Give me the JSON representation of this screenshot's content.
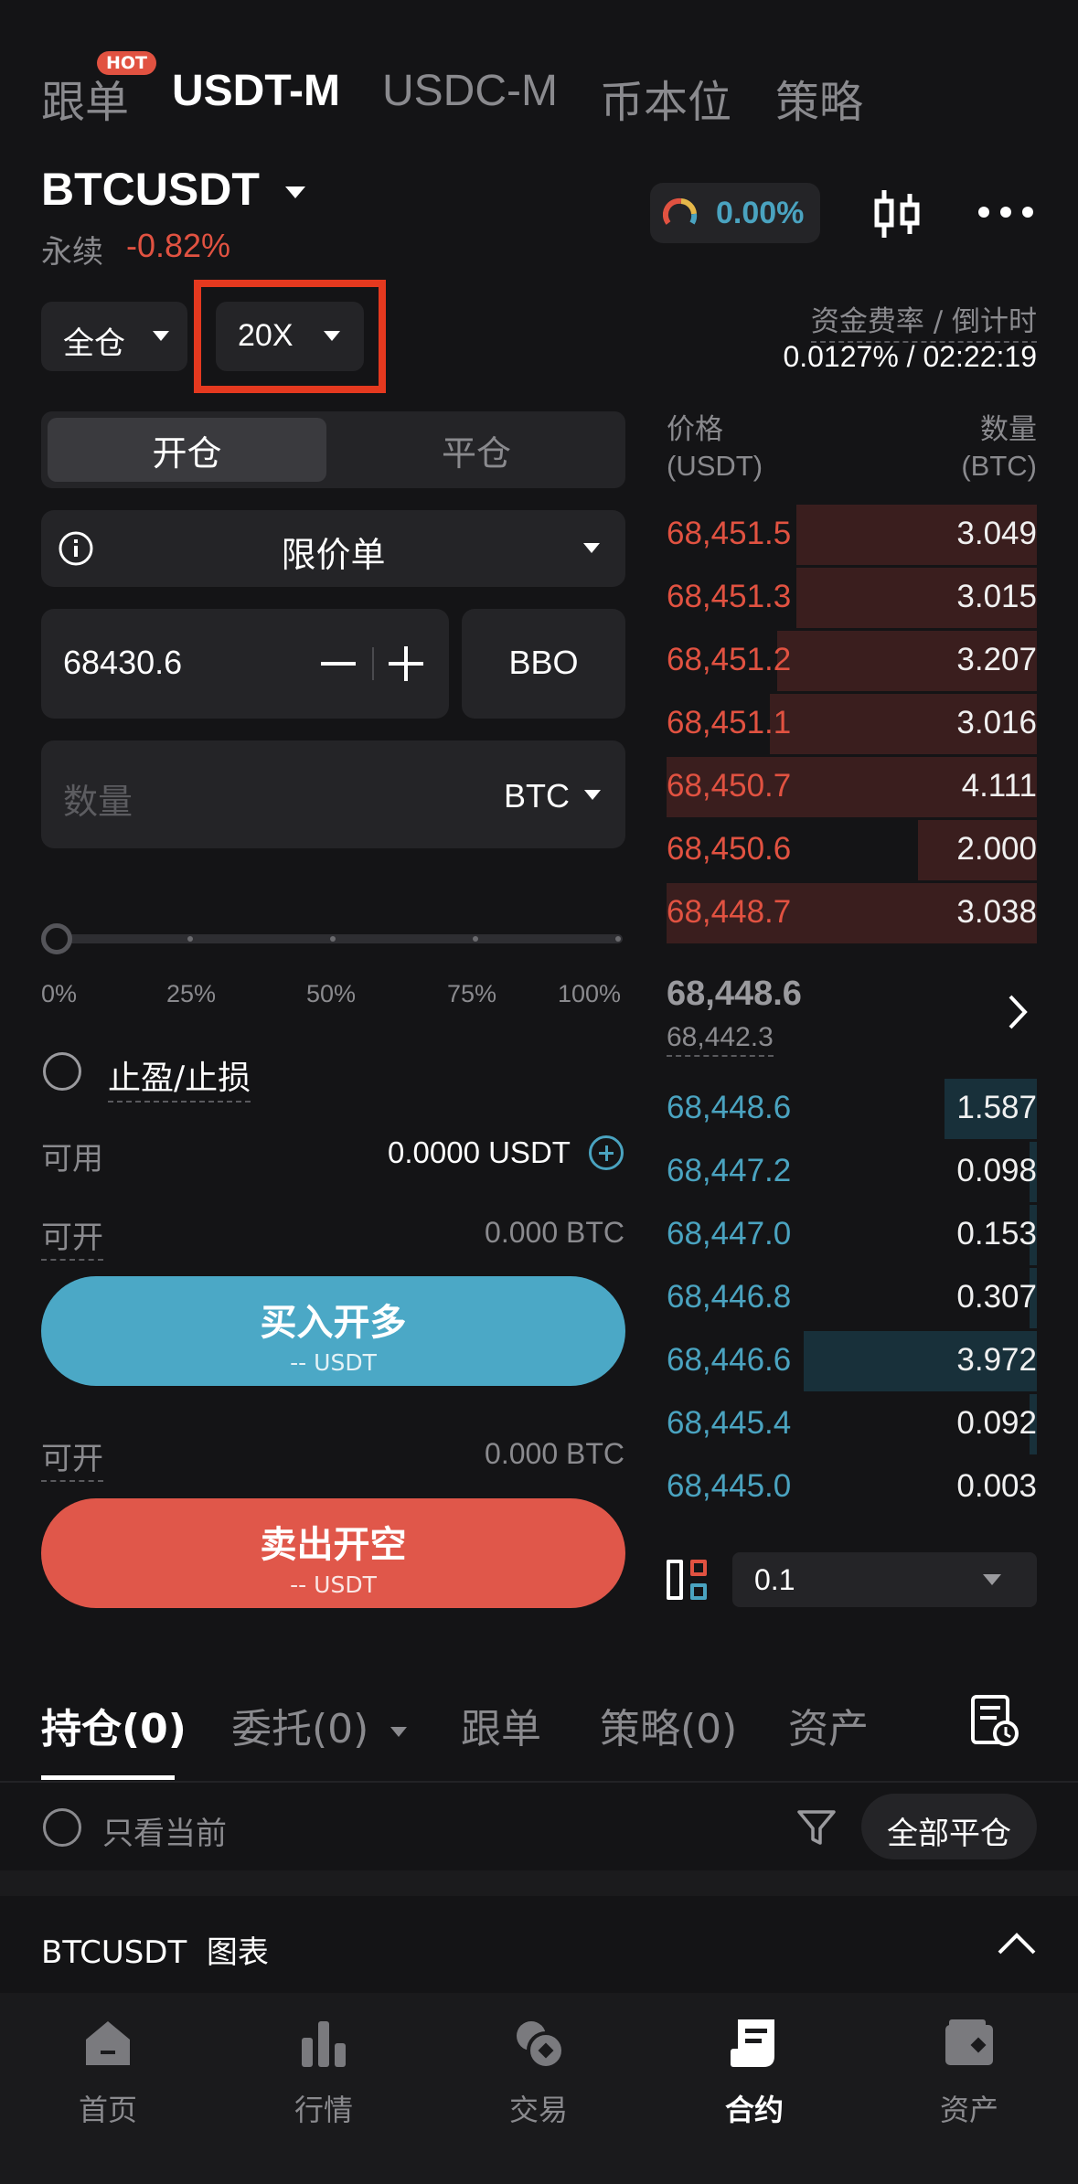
{
  "top_tabs": [
    {
      "label": "跟单",
      "active": false
    },
    {
      "label": "USDT-M",
      "active": true
    },
    {
      "label": "USDC-M",
      "active": false
    },
    {
      "label": "币本位",
      "active": false
    },
    {
      "label": "策略",
      "active": false
    }
  ],
  "hot_badge": "HOT",
  "symbol": "BTCUSDT",
  "contract_type": "永续",
  "change_pct": "-0.82%",
  "gauge_value": "0.00%",
  "margin_mode": "全仓",
  "leverage": "20X",
  "funding": {
    "label": "资金费率 / 倒计时",
    "value": "0.0127% / 02:22:19"
  },
  "segment": {
    "open": "开仓",
    "close": "平仓"
  },
  "order_type": "限价单",
  "price_input": "68430.6",
  "bbo_label": "BBO",
  "quantity": {
    "placeholder": "数量",
    "unit": "BTC"
  },
  "slider": {
    "value_pct": 0,
    "ticks": [
      "0%",
      "25%",
      "50%",
      "75%",
      "100%"
    ]
  },
  "tp_sl_label": "止盈/止损",
  "available": {
    "label": "可用",
    "value": "0.0000 USDT"
  },
  "can_open_long": {
    "label": "可开",
    "value": "0.000 BTC"
  },
  "buy_button": {
    "label": "买入开多",
    "sub": "-- USDT"
  },
  "can_open_short": {
    "label": "可开",
    "value": "0.000 BTC"
  },
  "sell_button": {
    "label": "卖出开空",
    "sub": "-- USDT"
  },
  "orderbook": {
    "price_header": "价格",
    "price_unit": "(USDT)",
    "qty_header": "数量",
    "qty_unit": "(BTC)",
    "asks": [
      {
        "price": "68,451.5",
        "qty": "3.049",
        "depth": 0.65
      },
      {
        "price": "68,451.3",
        "qty": "3.015",
        "depth": 0.65
      },
      {
        "price": "68,451.2",
        "qty": "3.207",
        "depth": 0.7
      },
      {
        "price": "68,451.1",
        "qty": "3.016",
        "depth": 0.72
      },
      {
        "price": "68,450.7",
        "qty": "4.111",
        "depth": 1.0
      },
      {
        "price": "68,450.6",
        "qty": "2.000",
        "depth": 0.32
      },
      {
        "price": "68,448.7",
        "qty": "3.038",
        "depth": 1.0
      }
    ],
    "last_price": "68,448.6",
    "mark_price": "68,442.3",
    "bids": [
      {
        "price": "68,448.6",
        "qty": "1.587",
        "depth": 0.25
      },
      {
        "price": "68,447.2",
        "qty": "0.098",
        "depth": 0.02
      },
      {
        "price": "68,447.0",
        "qty": "0.153",
        "depth": 0.02
      },
      {
        "price": "68,446.8",
        "qty": "0.307",
        "depth": 0.02
      },
      {
        "price": "68,446.6",
        "qty": "3.972",
        "depth": 0.63
      },
      {
        "price": "68,445.4",
        "qty": "0.092",
        "depth": 0.02
      },
      {
        "price": "68,445.0",
        "qty": "0.003",
        "depth": 0.0
      }
    ],
    "precision": "0.1"
  },
  "bottom_tabs": [
    {
      "label": "持仓(0)",
      "active": true
    },
    {
      "label": "委托(0)",
      "active": false
    },
    {
      "label": "跟单",
      "active": false
    },
    {
      "label": "策略(0)",
      "active": false
    },
    {
      "label": "资产",
      "active": false
    }
  ],
  "only_current": "只看当前",
  "close_all": "全部平仓",
  "chart_section": "BTCUSDT  图表",
  "nav": [
    {
      "label": "首页",
      "icon": "home-icon",
      "active": false
    },
    {
      "label": "行情",
      "icon": "market-icon",
      "active": false
    },
    {
      "label": "交易",
      "icon": "trade-icon",
      "active": false
    },
    {
      "label": "合约",
      "icon": "futures-icon",
      "active": true
    },
    {
      "label": "资产",
      "icon": "wallet-icon",
      "active": false
    }
  ],
  "colors": {
    "background": "#141416",
    "ask_red": "#e15241",
    "bid_blue": "#4aa3c0",
    "buy_button": "#4ba8c6",
    "sell_button": "#e0574a",
    "highlight_box": "#e5391f"
  }
}
